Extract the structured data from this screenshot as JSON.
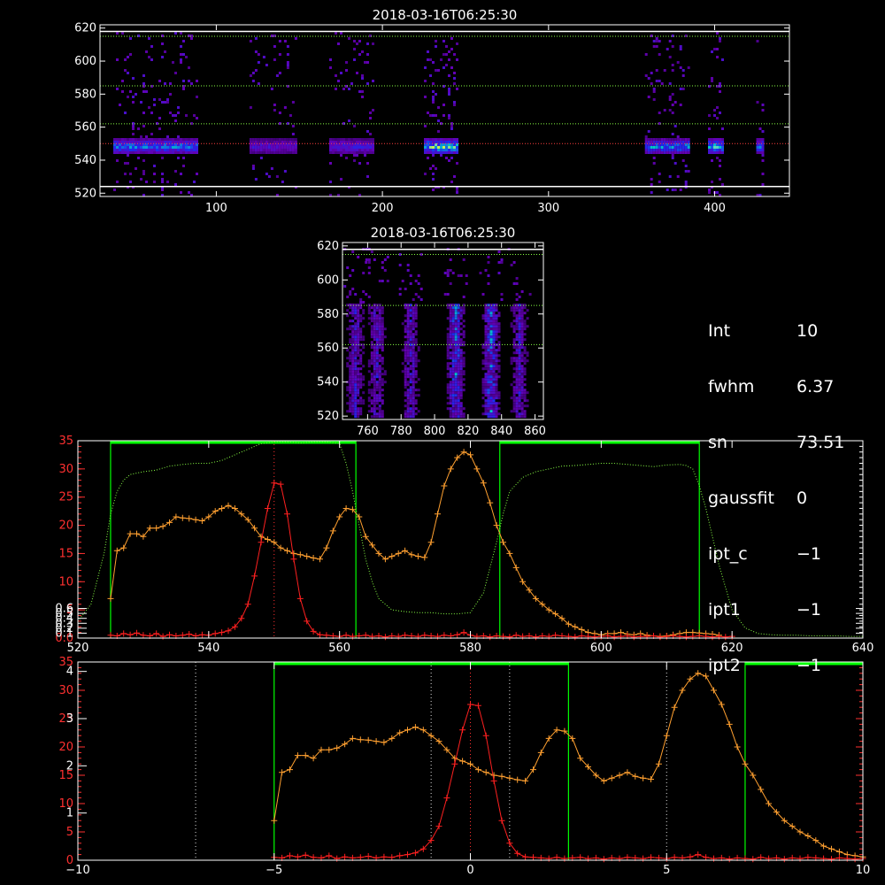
{
  "info_panel": {
    "rows": [
      {
        "label": "Int",
        "value": "10"
      },
      {
        "label": "fwhm",
        "value": "6.37"
      },
      {
        "label": "sn",
        "value": "73.51"
      },
      {
        "label": "gaussfit",
        "value": "0"
      },
      {
        "label": "ipt_c",
        "value": "−1"
      },
      {
        "label": "ipt1",
        "value": "−1"
      },
      {
        "label": "ipt2",
        "value": "−1"
      }
    ]
  },
  "colors": {
    "axis": "#ffffff",
    "red_axis": "#ff3030",
    "green_box": "#00ff00",
    "orange_series": "#ffa030",
    "red_series": "#ff2020",
    "dotted_green": "#88ff44"
  },
  "chart_data": [
    {
      "id": "panel-top-image",
      "type": "heatmap",
      "title": "2018-03-16T06:25:30",
      "xlim": [
        30,
        445
      ],
      "ylim": [
        518,
        622
      ],
      "xticks": [
        100,
        200,
        300,
        400
      ],
      "yticks": [
        520,
        540,
        560,
        580,
        600,
        620
      ],
      "hlines_white": [
        524,
        618
      ],
      "hlines_dotted_green": [
        562,
        585,
        615
      ],
      "hline_dotted_red": 550,
      "bands": [
        {
          "x0": 38,
          "x1": 88,
          "intensity": 0.75
        },
        {
          "x0": 120,
          "x1": 148,
          "intensity": 0.45
        },
        {
          "x0": 168,
          "x1": 195,
          "intensity": 0.5
        },
        {
          "x0": 225,
          "x1": 245,
          "intensity": 1.0
        },
        {
          "x0": 358,
          "x1": 385,
          "intensity": 0.8
        },
        {
          "x0": 396,
          "x1": 405,
          "intensity": 0.9
        },
        {
          "x0": 425,
          "x1": 429,
          "intensity": 0.7
        }
      ],
      "line_center": 549
    },
    {
      "id": "panel-mid-image",
      "type": "heatmap",
      "title": "2018-03-16T06:25:30",
      "xlim": [
        745,
        865
      ],
      "ylim": [
        518,
        622
      ],
      "xticks": [
        760,
        780,
        800,
        820,
        840,
        860
      ],
      "yticks": [
        520,
        540,
        560,
        580,
        600,
        620
      ],
      "hlines_white": [
        618
      ],
      "hlines_dotted_green": [
        562,
        585,
        615
      ],
      "columns": [
        752,
        765,
        785,
        812,
        833,
        850
      ]
    },
    {
      "id": "panel-spectrum-upper",
      "type": "line",
      "xlim": [
        520,
        640
      ],
      "xticks": [
        520,
        540,
        560,
        580,
        600,
        620,
        640
      ],
      "left_red_ylim": [
        0,
        35
      ],
      "left_red_yticks": [
        0,
        5,
        10,
        15,
        20,
        25,
        30,
        35
      ],
      "left_red_yticklabels": [
        "0.0",
        "5",
        "10",
        "15",
        "20",
        "25",
        "30",
        "35"
      ],
      "left_white_ylim": [
        0,
        4
      ],
      "left_white_yticks": [
        0.1,
        0.2,
        0.3,
        0.4,
        0.5,
        0.6
      ],
      "left_white_yticklabels": [
        "0.1",
        "0.2",
        "0.3",
        "0.4",
        "0.5",
        "0.6"
      ],
      "green_boxes": [
        [
          525,
          562.5
        ],
        [
          584.5,
          615
        ]
      ],
      "vline_dotted_red": 550,
      "series": [
        {
          "color": "orange",
          "x": [
            525,
            526,
            527,
            528,
            529,
            530,
            531,
            532,
            533,
            534,
            535,
            536,
            537,
            538,
            539,
            540,
            541,
            542,
            543,
            544,
            545,
            546,
            547,
            548,
            549,
            550,
            551,
            552,
            553,
            554,
            555,
            556,
            557,
            558,
            559,
            560,
            561,
            562,
            563,
            564,
            565,
            566,
            567,
            568,
            569,
            570,
            571,
            572,
            573,
            574,
            575,
            576,
            577,
            578,
            579,
            580,
            581,
            582,
            583,
            584,
            585,
            586,
            587,
            588,
            589,
            590,
            591,
            592,
            593,
            594,
            595,
            596,
            597,
            598,
            599,
            600,
            601,
            602,
            603,
            604,
            605,
            606,
            607,
            608,
            609,
            610,
            611,
            612,
            613,
            614,
            615,
            616,
            617,
            618
          ],
          "y": [
            7,
            15.5,
            16,
            18.5,
            18.5,
            18,
            19.5,
            19.5,
            19.8,
            20.5,
            21.5,
            21.3,
            21.2,
            21,
            20.8,
            21.5,
            22.5,
            23,
            23.5,
            23,
            22,
            21,
            19.5,
            18,
            17.5,
            17,
            16,
            15.5,
            15,
            14.8,
            14.5,
            14.2,
            14,
            16,
            19,
            21.5,
            23,
            22.8,
            21.5,
            18,
            16.5,
            15,
            14,
            14.5,
            15,
            15.5,
            14.8,
            14.5,
            14.3,
            17,
            22,
            27,
            30,
            32,
            33,
            32.5,
            30,
            27.5,
            24,
            20,
            17,
            15,
            12.5,
            10,
            8.5,
            7,
            6,
            5,
            4.3,
            3.5,
            2.5,
            2,
            1.5,
            1,
            0.8,
            0.6,
            0.8,
            0.8,
            1,
            0.7,
            0.6,
            0.8,
            0.5,
            0.4,
            0.3,
            0.4,
            0.6,
            0.8,
            1,
            1,
            0.9,
            0.8,
            0.7,
            0.5
          ]
        },
        {
          "color": "red",
          "x": [
            525,
            526,
            527,
            528,
            529,
            530,
            531,
            532,
            533,
            534,
            535,
            536,
            537,
            538,
            539,
            540,
            541,
            542,
            543,
            544,
            545,
            546,
            547,
            548,
            549,
            550,
            551,
            552,
            553,
            554,
            555,
            556,
            557,
            558,
            559,
            560,
            561,
            562,
            563,
            564,
            565,
            566,
            567,
            568,
            569,
            570,
            571,
            572,
            573,
            574,
            575,
            576,
            577,
            578,
            579,
            580,
            581,
            582,
            583,
            584,
            585,
            586,
            587,
            588,
            589,
            590,
            591,
            592,
            593,
            594,
            595,
            596,
            597,
            598,
            599,
            600,
            601,
            602,
            603,
            604,
            605,
            606,
            607,
            608,
            609,
            610,
            611,
            612,
            613,
            614,
            615,
            616,
            617,
            618,
            619,
            620
          ],
          "y": [
            0.5,
            0.4,
            0.8,
            0.6,
            0.9,
            0.5,
            0.4,
            0.8,
            0.3,
            0.6,
            0.4,
            0.5,
            0.7,
            0.4,
            0.6,
            0.5,
            0.8,
            1,
            1.3,
            2,
            3.5,
            6,
            11,
            17,
            23,
            27.5,
            27.3,
            22,
            14,
            7,
            3,
            1.2,
            0.6,
            0.5,
            0.4,
            0.3,
            0.5,
            0.3,
            0.4,
            0.5,
            0.3,
            0.4,
            0.2,
            0.4,
            0.3,
            0.5,
            0.4,
            0.3,
            0.5,
            0.4,
            0.3,
            0.5,
            0.4,
            0.6,
            1,
            0.5,
            0.3,
            0.4,
            0.2,
            0.4,
            0.3,
            0.2,
            0.5,
            0.3,
            0.4,
            0.2,
            0.4,
            0.3,
            0.5,
            0.4,
            0.3,
            0.2,
            0.4,
            0.3,
            0.2,
            0.3,
            0.4,
            0.2,
            0.3,
            0.4,
            0.2,
            0.3,
            0.3,
            0.4,
            0.2,
            0.3,
            0.4,
            0.3,
            0.2,
            0.3,
            0.4,
            0.3,
            0.2,
            0.3,
            0.2,
            0.3
          ]
        },
        {
          "color": "dotted-green",
          "x": [
            520,
            522,
            524,
            525,
            526,
            527,
            528,
            530,
            532,
            534,
            536,
            538,
            540,
            542,
            544,
            546,
            548,
            550,
            552,
            554,
            556,
            558,
            560,
            561,
            562,
            563,
            564,
            565,
            566,
            568,
            570,
            572,
            574,
            576,
            578,
            580,
            582,
            584,
            585,
            586,
            588,
            590,
            592,
            594,
            596,
            598,
            600,
            602,
            604,
            606,
            608,
            610,
            612,
            613,
            614,
            615,
            616,
            617,
            618,
            619,
            620,
            622,
            624,
            626,
            628,
            630,
            632,
            634,
            636,
            638,
            640
          ],
          "y": [
            3,
            6,
            15,
            22,
            26,
            28,
            29,
            29.5,
            29.8,
            30.5,
            30.8,
            31,
            31,
            31.5,
            32.5,
            33.5,
            34.5,
            34.8,
            34.8,
            34.6,
            34.8,
            34.8,
            34.5,
            31,
            26,
            20,
            14,
            10,
            7,
            5,
            4.7,
            4.5,
            4.5,
            4.3,
            4.3,
            4.5,
            8,
            17,
            22,
            26,
            28.5,
            29.5,
            30,
            30.5,
            30.6,
            30.8,
            31,
            31,
            30.8,
            30.6,
            30.4,
            30.7,
            30.8,
            30.6,
            30,
            27,
            23,
            18,
            13,
            9,
            5,
            1.8,
            0.8,
            0.6,
            0.5,
            0.5,
            0.4,
            0.4,
            0.4,
            0.3,
            0.3
          ]
        }
      ]
    },
    {
      "id": "panel-spectrum-lower",
      "type": "line",
      "xlim": [
        -10,
        10
      ],
      "xticks": [
        -10,
        -5,
        0,
        5,
        10
      ],
      "left_red_ylim": [
        0,
        35
      ],
      "left_red_yticks": [
        0,
        5,
        10,
        15,
        20,
        25,
        30,
        35
      ],
      "left_red_yticklabels": [
        "0",
        "5",
        "10",
        "15",
        "20",
        "25",
        "30",
        "35"
      ],
      "left_white_ylim": [
        0,
        4.2
      ],
      "left_white_yticks": [
        1,
        2,
        3,
        4
      ],
      "left_white_yticklabels": [
        "1",
        "2",
        "3",
        "4"
      ],
      "right_red_yticks": [
        0,
        5,
        10,
        15,
        20,
        25,
        30,
        35
      ],
      "green_boxes": [
        [
          -5,
          2.5
        ],
        [
          7,
          10
        ]
      ],
      "vlines_dotted_white": [
        -7,
        -1,
        1,
        5
      ],
      "vline_dotted_red": 0,
      "series": [
        {
          "color": "orange",
          "x": [
            -5,
            -4.8,
            -4.6,
            -4.4,
            -4.2,
            -4,
            -3.8,
            -3.6,
            -3.4,
            -3.2,
            -3,
            -2.8,
            -2.6,
            -2.4,
            -2.2,
            -2,
            -1.8,
            -1.6,
            -1.4,
            -1.2,
            -1,
            -0.8,
            -0.6,
            -0.4,
            -0.2,
            0,
            0.2,
            0.4,
            0.6,
            0.8,
            1,
            1.2,
            1.4,
            1.6,
            1.8,
            2,
            2.2,
            2.4,
            2.6,
            2.8,
            3,
            3.2,
            3.4,
            3.6,
            3.8,
            4,
            4.2,
            4.4,
            4.6,
            4.8,
            5,
            5.2,
            5.4,
            5.6,
            5.8,
            6,
            6.2,
            6.4,
            6.6,
            6.8,
            7,
            7.2,
            7.4,
            7.6,
            7.8,
            8,
            8.2,
            8.4,
            8.6,
            8.8,
            9,
            9.2,
            9.4,
            9.6,
            9.8,
            10
          ],
          "y": [
            7,
            15.5,
            16,
            18.5,
            18.5,
            18,
            19.5,
            19.5,
            19.8,
            20.5,
            21.5,
            21.3,
            21.2,
            21,
            20.8,
            21.5,
            22.5,
            23,
            23.5,
            23,
            22,
            21,
            19.5,
            18,
            17.5,
            17,
            16,
            15.5,
            15,
            14.8,
            14.5,
            14.2,
            14,
            16,
            19,
            21.5,
            23,
            22.8,
            21.5,
            18,
            16.5,
            15,
            14,
            14.5,
            15,
            15.5,
            14.8,
            14.5,
            14.3,
            17,
            22,
            27,
            30,
            32,
            33,
            32.5,
            30,
            27.5,
            24,
            20,
            17,
            15,
            12.5,
            10,
            8.5,
            7,
            6,
            5,
            4.3,
            3.5,
            2.5,
            2,
            1.5,
            1,
            0.8,
            0.6
          ]
        },
        {
          "color": "red",
          "x": [
            -5,
            -4.8,
            -4.6,
            -4.4,
            -4.2,
            -4,
            -3.8,
            -3.6,
            -3.4,
            -3.2,
            -3,
            -2.8,
            -2.6,
            -2.4,
            -2.2,
            -2,
            -1.8,
            -1.6,
            -1.4,
            -1.2,
            -1,
            -0.8,
            -0.6,
            -0.4,
            -0.2,
            0,
            0.2,
            0.4,
            0.6,
            0.8,
            1,
            1.2,
            1.4,
            1.6,
            1.8,
            2,
            2.2,
            2.4,
            2.6,
            2.8,
            3,
            3.2,
            3.4,
            3.6,
            3.8,
            4,
            4.2,
            4.4,
            4.6,
            4.8,
            5,
            5.2,
            5.4,
            5.6,
            5.8,
            6,
            6.2,
            6.4,
            6.6,
            6.8,
            7,
            7.2,
            7.4,
            7.6,
            7.8,
            8,
            8.2,
            8.4,
            8.6,
            8.8,
            9,
            9.2,
            9.4,
            9.6,
            9.8,
            10
          ],
          "y": [
            0.5,
            0.4,
            0.8,
            0.6,
            0.9,
            0.5,
            0.4,
            0.8,
            0.3,
            0.6,
            0.4,
            0.5,
            0.7,
            0.4,
            0.6,
            0.5,
            0.8,
            1,
            1.3,
            2,
            3.5,
            6,
            11,
            17,
            23,
            27.5,
            27.3,
            22,
            14,
            7,
            3,
            1.2,
            0.6,
            0.5,
            0.4,
            0.3,
            0.5,
            0.3,
            0.4,
            0.5,
            0.3,
            0.4,
            0.2,
            0.4,
            0.3,
            0.5,
            0.4,
            0.3,
            0.5,
            0.4,
            0.3,
            0.5,
            0.4,
            0.6,
            1,
            0.5,
            0.3,
            0.4,
            0.2,
            0.4,
            0.3,
            0.2,
            0.5,
            0.3,
            0.4,
            0.2,
            0.4,
            0.3,
            0.5,
            0.4,
            0.3,
            0.2,
            0.4,
            0.3,
            0.2,
            0.3
          ]
        }
      ]
    }
  ]
}
